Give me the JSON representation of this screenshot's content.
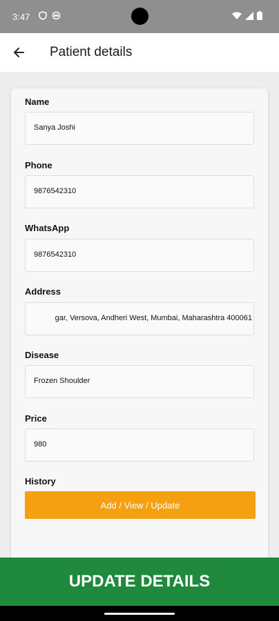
{
  "status_bar": {
    "time": "3:47",
    "colors": {
      "background": "#8f8f8f"
    },
    "icons": [
      "shield-icon",
      "sim-icon",
      "wifi-icon",
      "signal-icon",
      "battery-icon"
    ]
  },
  "app_bar": {
    "title": "Patient details",
    "back_icon": "arrow-left-icon"
  },
  "form": {
    "name": {
      "label": "Name",
      "value": "Sanya Joshi"
    },
    "phone": {
      "label": "Phone",
      "value": "9876542310"
    },
    "whatsapp": {
      "label": "WhatsApp",
      "value": "9876542310"
    },
    "address": {
      "label": "Address",
      "value": "gar, Versova, Andheri West, Mumbai, Maharashtra 400061"
    },
    "disease": {
      "label": "Disease",
      "value": "Frozen Shoulder"
    },
    "price": {
      "label": "Price",
      "value": "980"
    },
    "history": {
      "label": "History",
      "button_label": "Add / View / Update"
    }
  },
  "footer": {
    "update_label": "UPDATE DETAILS"
  },
  "colors": {
    "accent_orange": "#f5a010",
    "update_green": "#1f8a3e"
  }
}
